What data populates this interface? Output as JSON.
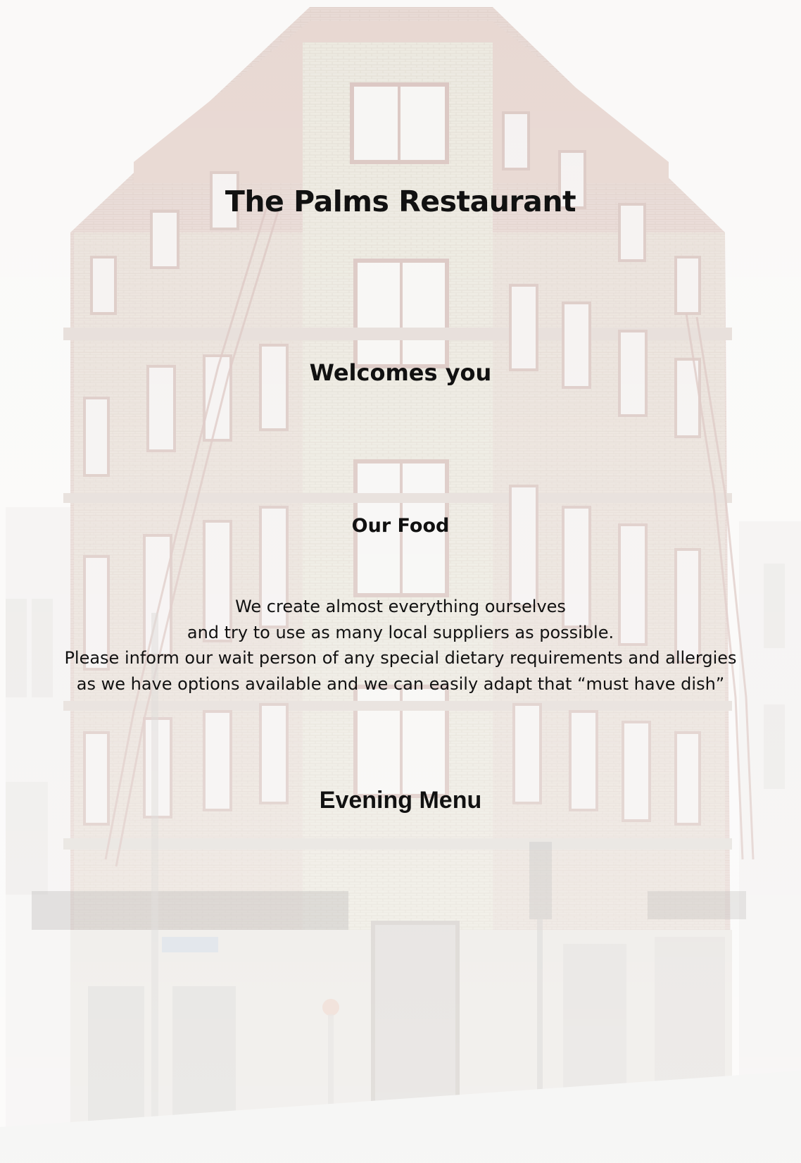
{
  "page": {
    "title": "The Palms Restaurant",
    "welcome": "Welcomes you",
    "food_heading": "Our Food",
    "food_lines": [
      "We create almost everything ourselves",
      "and try to use as many local suppliers as possible.",
      "Please inform our wait person of any special dietary requirements and allergies",
      "as we have options available and we can easily adapt that “must have dish”"
    ],
    "menu_heading": "Evening Menu"
  },
  "background": {
    "description_icon": "building-photo",
    "sky_color": "#f4f3f1",
    "brick_color": "#d9c9c2",
    "stone_color": "#e4e0d4"
  }
}
